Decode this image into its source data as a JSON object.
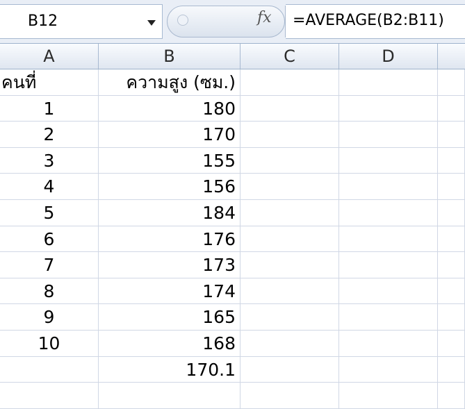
{
  "name_box": {
    "value": "B12"
  },
  "formula_bar": {
    "fx_label": "fx",
    "formula": "=AVERAGE(B2:B11)"
  },
  "columns": [
    "A",
    "B",
    "C",
    "D"
  ],
  "rows": [
    {
      "a": "คนที่",
      "b": "ความสูง (ซม.)"
    },
    {
      "a": "1",
      "b": "180"
    },
    {
      "a": "2",
      "b": "170"
    },
    {
      "a": "3",
      "b": "155"
    },
    {
      "a": "4",
      "b": "156"
    },
    {
      "a": "5",
      "b": "184"
    },
    {
      "a": "6",
      "b": "176"
    },
    {
      "a": "7",
      "b": "173"
    },
    {
      "a": "8",
      "b": "174"
    },
    {
      "a": "9",
      "b": "165"
    },
    {
      "a": "10",
      "b": "168"
    },
    {
      "a": "",
      "b": "170.1"
    },
    {
      "a": "",
      "b": ""
    }
  ]
}
